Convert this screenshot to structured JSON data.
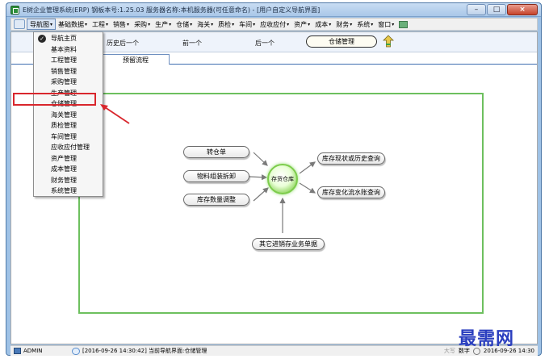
{
  "window": {
    "title": "E树企业管理系统(ERP) 钢板本号:1.25.03 服务器名称:本机服务器(可任意命名) - [用户自定义导航界面]",
    "buttons": {
      "minimize": "–",
      "maximize": "□",
      "close": "×"
    }
  },
  "menubar": {
    "items": [
      {
        "label": "导航图"
      },
      {
        "label": "基础数据"
      },
      {
        "label": "工程"
      },
      {
        "label": "销售"
      },
      {
        "label": "采购"
      },
      {
        "label": "生产"
      },
      {
        "label": "仓储"
      },
      {
        "label": "海关"
      },
      {
        "label": "质检"
      },
      {
        "label": "车间"
      },
      {
        "label": "应收应付"
      },
      {
        "label": "资产"
      },
      {
        "label": "成本"
      },
      {
        "label": "财务"
      },
      {
        "label": "系统"
      },
      {
        "label": "窗口"
      }
    ],
    "arrow": "▾"
  },
  "dropdown": {
    "items": [
      {
        "label": "导航主页",
        "checked": true
      },
      {
        "label": "基本资料"
      },
      {
        "label": "工程管理"
      },
      {
        "label": "销售管理"
      },
      {
        "label": "采购管理"
      },
      {
        "label": "生产管理"
      },
      {
        "label": "仓储管理"
      },
      {
        "label": "海关管理"
      },
      {
        "label": "质检管理"
      },
      {
        "label": "车间管理"
      },
      {
        "label": "应收应付管理"
      },
      {
        "label": "资产管理"
      },
      {
        "label": "成本管理"
      },
      {
        "label": "财务管理"
      },
      {
        "label": "系统管理"
      }
    ],
    "check_glyph": "✓"
  },
  "navstrip": {
    "history": "历史后一个",
    "prev": "前一个",
    "next": "后一个",
    "current": "仓储管理"
  },
  "tab": {
    "label": "预留流程"
  },
  "diagram": {
    "hub": "存货仓库",
    "left_nodes": [
      "转仓单",
      "物料组装拆卸",
      "库存数量调整"
    ],
    "right_nodes": [
      "库存现状或历史查询",
      "库存变化流水账查询"
    ],
    "bottom_node": "其它进销存业务单据"
  },
  "status": {
    "user": "ADMIN",
    "message": "[2016-09-26 14:30:42] 当前导航界面:仓储管理",
    "caps": "大写",
    "num": "数字",
    "clock": "2016-09-26 14:30"
  },
  "watermark": "最需网",
  "colors": {
    "frame": "#6dc05e",
    "highlight": "#d9262c",
    "title_bar": "#a9c7e8"
  }
}
